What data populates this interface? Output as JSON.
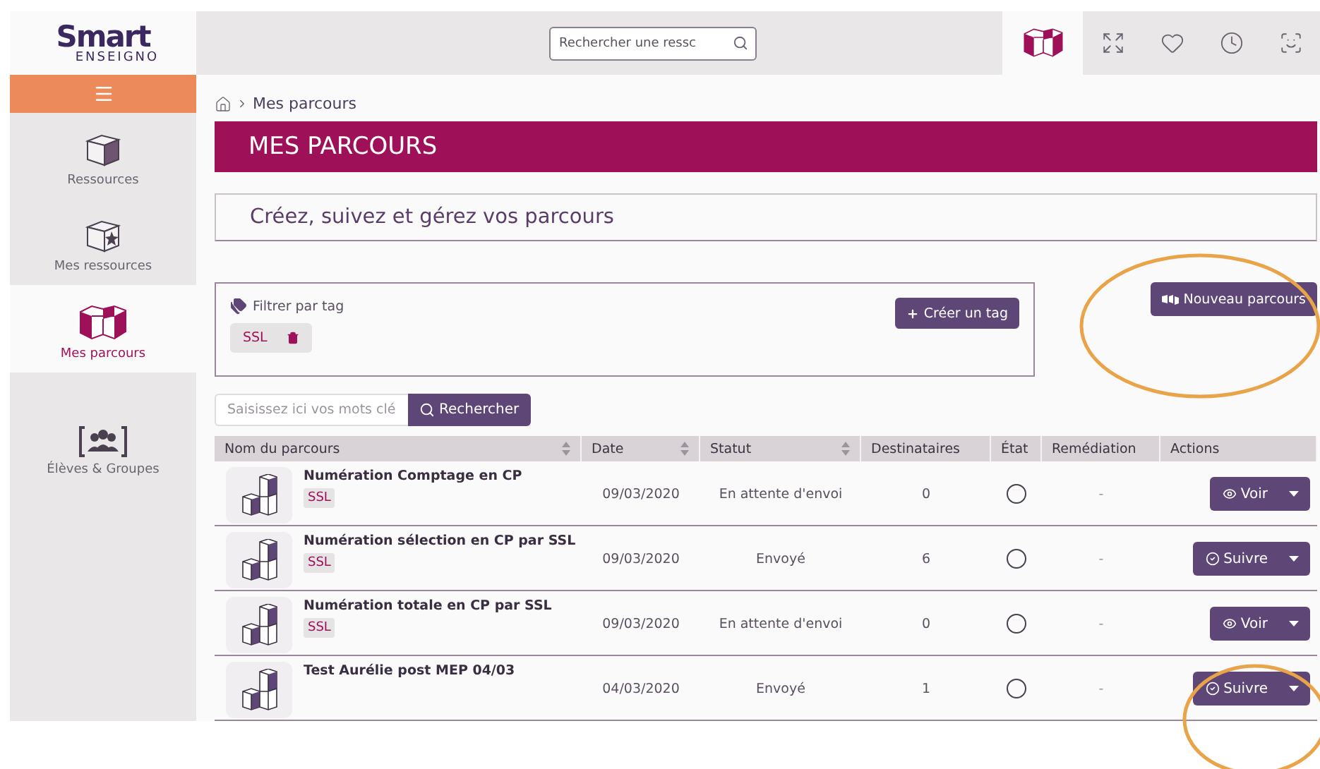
{
  "logo": {
    "name": "Smart",
    "sub": "ENSEIGNO"
  },
  "search": {
    "placeholder": "Rechercher une ressc"
  },
  "toolbar_icons": [
    {
      "kind": "cubes",
      "selected": true
    },
    {
      "kind": "expand",
      "selected": false
    },
    {
      "kind": "heart",
      "selected": false
    },
    {
      "kind": "clock",
      "selected": false
    },
    {
      "kind": "face",
      "selected": false
    }
  ],
  "sidebar": {
    "items": [
      {
        "kind": "cube",
        "label": "Ressources",
        "selected": false
      },
      {
        "kind": "star-cube",
        "label": "Mes ressources",
        "selected": false
      },
      {
        "kind": "cubes",
        "label": "Mes parcours",
        "selected": true
      },
      {
        "kind": "group",
        "label": "Élèves & Groupes",
        "selected": false
      }
    ]
  },
  "breadcrumb": "Mes parcours",
  "title": "MES PARCOURS",
  "subtitle": "Créez, suivez et gérez vos parcours",
  "filter": {
    "label": "Filtrer par tag",
    "tags": [
      "SSL"
    ],
    "create_button": "Créer un tag"
  },
  "new_button": "Nouveau parcours",
  "keyword_search": {
    "placeholder": "Saisissez ici vos mots clé",
    "button": "Rechercher"
  },
  "table": {
    "columns": [
      {
        "label": "Nom du parcours",
        "sortable": true
      },
      {
        "label": "Date",
        "sortable": true
      },
      {
        "label": "Statut",
        "sortable": true
      },
      {
        "label": "Destinataires",
        "sortable": false
      },
      {
        "label": "État",
        "sortable": false
      },
      {
        "label": "Remédiation",
        "sortable": false
      },
      {
        "label": "Actions",
        "sortable": false
      }
    ],
    "rows": [
      {
        "name": "Numération Comptage en CP",
        "tag": "SSL",
        "date": "09/03/2020",
        "status": "En attente d'envoi",
        "recipients": "0",
        "remediation": "-",
        "action": {
          "kind": "view",
          "label": "Voir"
        }
      },
      {
        "name": "Numération sélection en CP par SSL",
        "tag": "SSL",
        "date": "09/03/2020",
        "status": "Envoyé",
        "recipients": "6",
        "remediation": "-",
        "action": {
          "kind": "follow",
          "label": "Suivre"
        }
      },
      {
        "name": "Numération totale en CP par SSL",
        "tag": "SSL",
        "date": "09/03/2020",
        "status": "En attente d'envoi",
        "recipients": "0",
        "remediation": "-",
        "action": {
          "kind": "view",
          "label": "Voir"
        }
      },
      {
        "name": "Test Aurélie post MEP 04/03",
        "date": "04/03/2020",
        "status": "Envoyé",
        "recipients": "1",
        "remediation": "-",
        "action": {
          "kind": "follow",
          "label": "Suivre"
        }
      }
    ]
  }
}
